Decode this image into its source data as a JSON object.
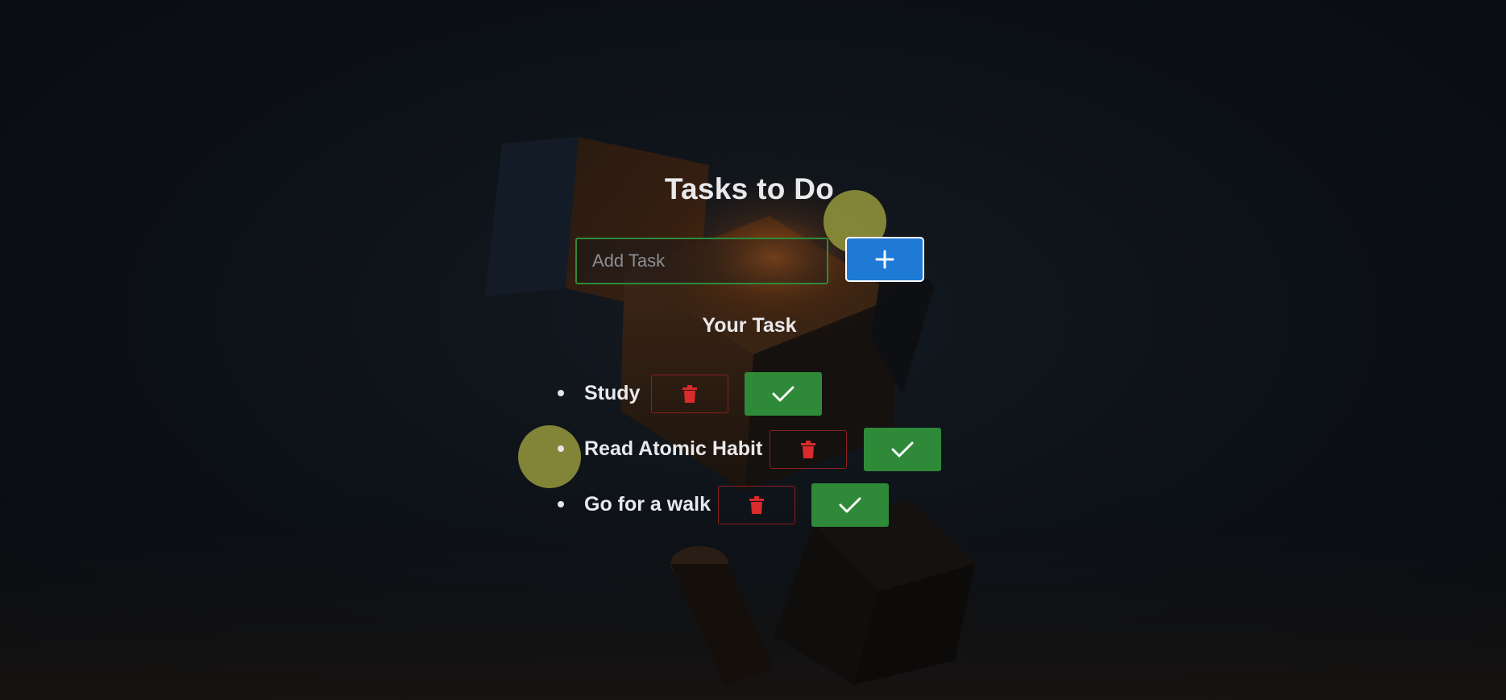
{
  "app": {
    "title": "Tasks to Do"
  },
  "form": {
    "input_value": "",
    "input_placeholder": "Add Task",
    "add_icon": "plus-icon"
  },
  "list": {
    "heading": "Your Task",
    "tasks": [
      {
        "label": "Study",
        "delete_icon": "trash-icon",
        "done_icon": "check-icon"
      },
      {
        "label": "Read Atomic Habit",
        "delete_icon": "trash-icon",
        "done_icon": "check-icon"
      },
      {
        "label": "Go for a walk",
        "delete_icon": "trash-icon",
        "done_icon": "check-icon"
      }
    ]
  },
  "colors": {
    "background": "#0b0f14",
    "add_button": "#1f7ad6",
    "input_border": "#2f8a3a",
    "done_button": "#2e8a38",
    "delete_border": "#8a2020",
    "delete_icon": "#d92b2b",
    "blob": "#8c8f3a"
  }
}
